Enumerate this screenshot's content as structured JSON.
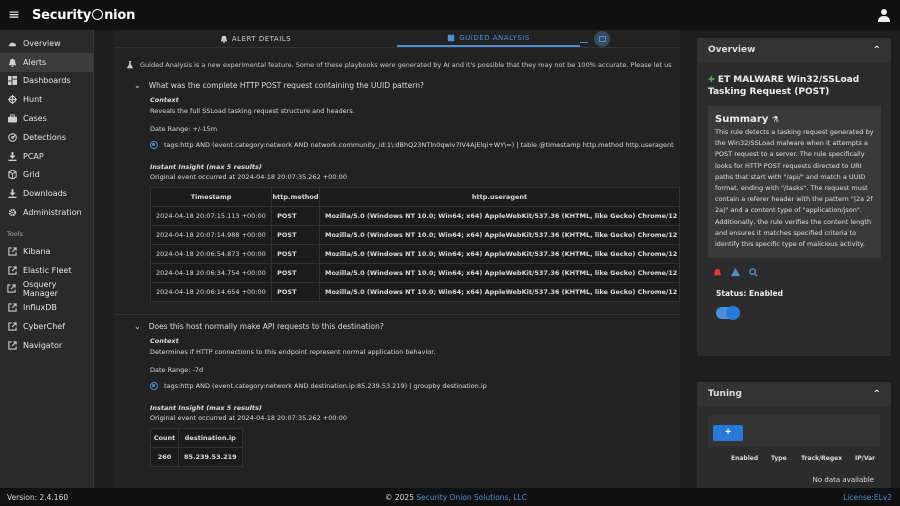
{
  "app": {
    "brand_left": "Security",
    "brand_right": "nion"
  },
  "sidebar": {
    "items": [
      {
        "label": "Overview",
        "icon": "gauge-icon"
      },
      {
        "label": "Alerts",
        "icon": "bell-icon",
        "active": true
      },
      {
        "label": "Dashboards",
        "icon": "dashboard-icon"
      },
      {
        "label": "Hunt",
        "icon": "crosshair-icon"
      },
      {
        "label": "Cases",
        "icon": "briefcase-icon"
      },
      {
        "label": "Detections",
        "icon": "radar-icon"
      },
      {
        "label": "PCAP",
        "icon": "download-icon"
      },
      {
        "label": "Grid",
        "icon": "grid-icon"
      },
      {
        "label": "Downloads",
        "icon": "download-icon"
      },
      {
        "label": "Administration",
        "icon": "gear-icon"
      }
    ],
    "tools_label": "Tools",
    "tools": [
      {
        "label": "Kibana"
      },
      {
        "label": "Elastic Fleet"
      },
      {
        "label": "Osquery Manager"
      },
      {
        "label": "InfluxDB"
      },
      {
        "label": "CyberChef"
      },
      {
        "label": "Navigator"
      }
    ]
  },
  "tabs": {
    "alert_details": "ALERT DETAILS",
    "guided_analysis": "GUIDED ANALYSIS"
  },
  "banner": "Guided Analysis is a new experimental feature. Some of these playbooks were generated by AI and it's possible that they may not be 100% accurate. Please let us",
  "questions": [
    {
      "title": "What was the complete HTTP POST request containing the UUID pattern?",
      "context_label": "Context",
      "context": "Reveals the full SSLoad tasking request structure and headers.",
      "date_range": "Date Range: +/-15m",
      "query": "tags:http AND (event.category:network AND network.community_id:1\\:dBhQ23NTln0qwiv7IV4AjElqi+WY\\=) | table @timestamp http.method http.useragent",
      "insight_label": "Instant Insight (max 5 results)",
      "insight_sub": "Original event occurred at 2024-04-18 20:07:35.262 +00:00",
      "columns": [
        "Timestamp",
        "http.method",
        "http.useragent"
      ],
      "rows": [
        [
          "2024-04-18 20:07:15.113 +00:00",
          "POST",
          "Mozilla/5.0 (Windows NT 10.0; Win64; x64) AppleWebKit/537.36 (KHTML, like Gecko) Chrome/12"
        ],
        [
          "2024-04-18 20:07:14.988 +00:00",
          "POST",
          "Mozilla/5.0 (Windows NT 10.0; Win64; x64) AppleWebKit/537.36 (KHTML, like Gecko) Chrome/12"
        ],
        [
          "2024-04-18 20:06:54.873 +00:00",
          "POST",
          "Mozilla/5.0 (Windows NT 10.0; Win64; x64) AppleWebKit/537.36 (KHTML, like Gecko) Chrome/12"
        ],
        [
          "2024-04-18 20:06:34.754 +00:00",
          "POST",
          "Mozilla/5.0 (Windows NT 10.0; Win64; x64) AppleWebKit/537.36 (KHTML, like Gecko) Chrome/12"
        ],
        [
          "2024-04-18 20:06:14.654 +00:00",
          "POST",
          "Mozilla/5.0 (Windows NT 10.0; Win64; x64) AppleWebKit/537.36 (KHTML, like Gecko) Chrome/12"
        ]
      ]
    },
    {
      "title": "Does this host normally make API requests to this destination?",
      "context_label": "Context",
      "context": "Determines if HTTP connections to this endpoint represent normal application behavior.",
      "date_range": "Date Range: -7d",
      "query": "tags:http AND (event.category:network AND destination.ip:85.239.53.219) | groupby destination.ip",
      "insight_label": "Instant Insight (max 5 results)",
      "insight_sub": "Original event occurred at 2024-04-18 20:07:35.262 +00:00",
      "columns": [
        "Count",
        "destination.ip"
      ],
      "rows": [
        [
          "260",
          "85.239.53.219"
        ]
      ]
    }
  ],
  "overview": {
    "header": "Overview",
    "title": "ET MALWARE Win32/SSLoad Tasking Request (POST)",
    "summary_label": "Summary",
    "summary": "This rule detects a tasking request generated by the Win32/SSLoad malware when it attempts a POST request to a server. The rule specifically looks for HTTP POST requests directed to URI paths that start with \"/api/\" and match a UUID format, ending with \"/tasks\". The request must contain a referer header with the pattern \"|2a 2f 2a|\" and a content type of \"application/json\". Additionally, the rule verifies the content length and ensures it matches specified criteria to identify this specific type of malicious activity.",
    "status": "Status: Enabled"
  },
  "tuning": {
    "header": "Tuning",
    "add_label": "+",
    "columns": [
      "Enabled",
      "Type",
      "Track/Regex",
      "IP/Var"
    ],
    "empty": "No data available"
  },
  "footer": {
    "version": "Version: 2.4.160",
    "copyright_prefix": "© 2025 ",
    "copyright_link": "Security Onion Solutions, LLC",
    "license": "License:ELv2"
  },
  "colors": {
    "accent": "#4a90d9",
    "alert_red": "#e53935"
  }
}
